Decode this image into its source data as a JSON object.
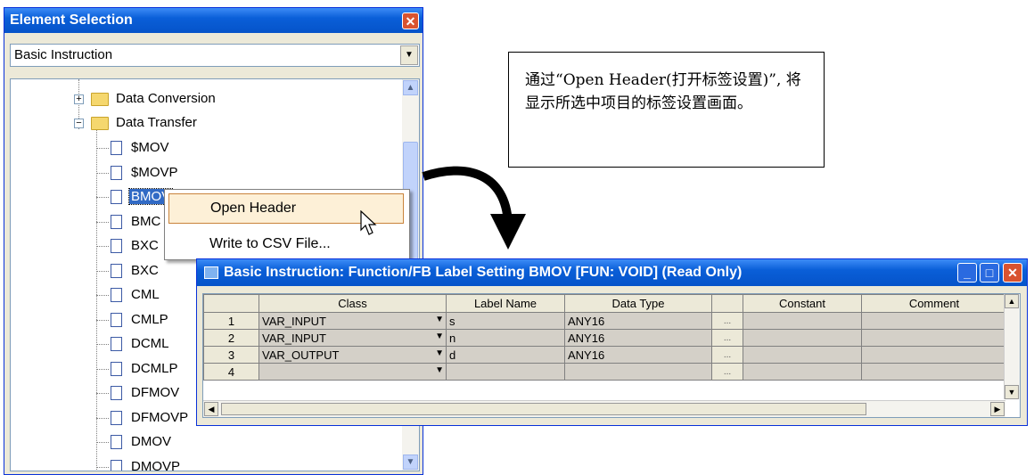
{
  "element_selection": {
    "title": "Element Selection",
    "close_icon": "close-icon",
    "combo_value": "Basic Instruction",
    "tree": {
      "folders": [
        {
          "label": "Data Conversion",
          "expanded": false
        },
        {
          "label": "Data Transfer",
          "expanded": true
        }
      ],
      "items": [
        "$MOV",
        "$MOVP",
        "BMOV",
        "BMC",
        "BXC",
        "BXC",
        "CML",
        "CMLP",
        "DCML",
        "DCMLP",
        "DFMOV",
        "DFMOVP",
        "DMOV",
        "DMOVP"
      ],
      "selected_index": 2
    }
  },
  "context_menu": {
    "items": [
      "Open Header",
      "Write to CSV File..."
    ],
    "highlighted_index": 0
  },
  "note": {
    "text": "通过“Open Header(打开标签设置)”, 将显示所选中项目的标签设置画面。"
  },
  "label_setting": {
    "title": "Basic Instruction: Function/FB Label Setting BMOV [FUN: VOID]  (Read Only)",
    "columns": [
      "Class",
      "Label Name",
      "Data Type",
      "",
      "Constant",
      "Comment"
    ],
    "rows": [
      {
        "num": "1",
        "class": "VAR_INPUT",
        "label": "s",
        "type": "ANY16",
        "ellipsis": "...",
        "constant": "",
        "comment": ""
      },
      {
        "num": "2",
        "class": "VAR_INPUT",
        "label": "n",
        "type": "ANY16",
        "ellipsis": "...",
        "constant": "",
        "comment": ""
      },
      {
        "num": "3",
        "class": "VAR_OUTPUT",
        "label": "d",
        "type": "ANY16",
        "ellipsis": "...",
        "constant": "",
        "comment": ""
      },
      {
        "num": "4",
        "class": "",
        "label": "",
        "type": "",
        "ellipsis": "...",
        "constant": "",
        "comment": ""
      }
    ]
  },
  "colors": {
    "titlebar": "#0553c9",
    "selection": "#316ac5",
    "menu_highlight": "#fdf0d7"
  }
}
